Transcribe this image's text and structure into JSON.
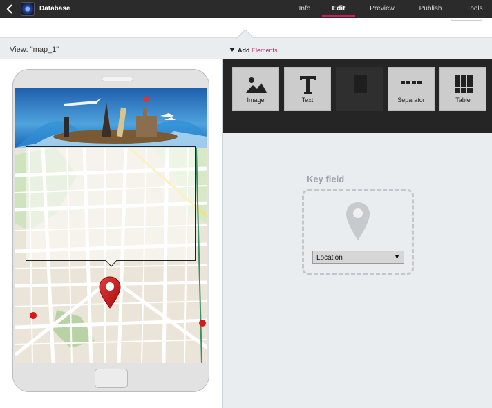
{
  "app": {
    "title": "Database"
  },
  "nav": {
    "tabs": [
      {
        "label": "Info"
      },
      {
        "label": "Edit"
      },
      {
        "label": "Preview"
      },
      {
        "label": "Publish"
      },
      {
        "label": "Tools"
      }
    ],
    "active": "Edit"
  },
  "view": {
    "label": "View: \"map_1\""
  },
  "add_elements": {
    "prefix": "Add",
    "accent": "Elements"
  },
  "tools": [
    {
      "label": "Image",
      "icon": "image-icon"
    },
    {
      "label": "Text",
      "icon": "text-icon"
    },
    {
      "label": "",
      "icon": "document-icon",
      "disabled": true
    },
    {
      "label": "Separator",
      "icon": "separator-icon"
    },
    {
      "label": "Table",
      "icon": "table-icon"
    }
  ],
  "key_field": {
    "title": "Key field",
    "select_value": "Location",
    "icon": "location-pin-icon"
  },
  "colors": {
    "accent": "#c82157",
    "topbar": "#2b2b2b",
    "palette_bg": "#252525",
    "pin_red": "#d31b1b"
  }
}
